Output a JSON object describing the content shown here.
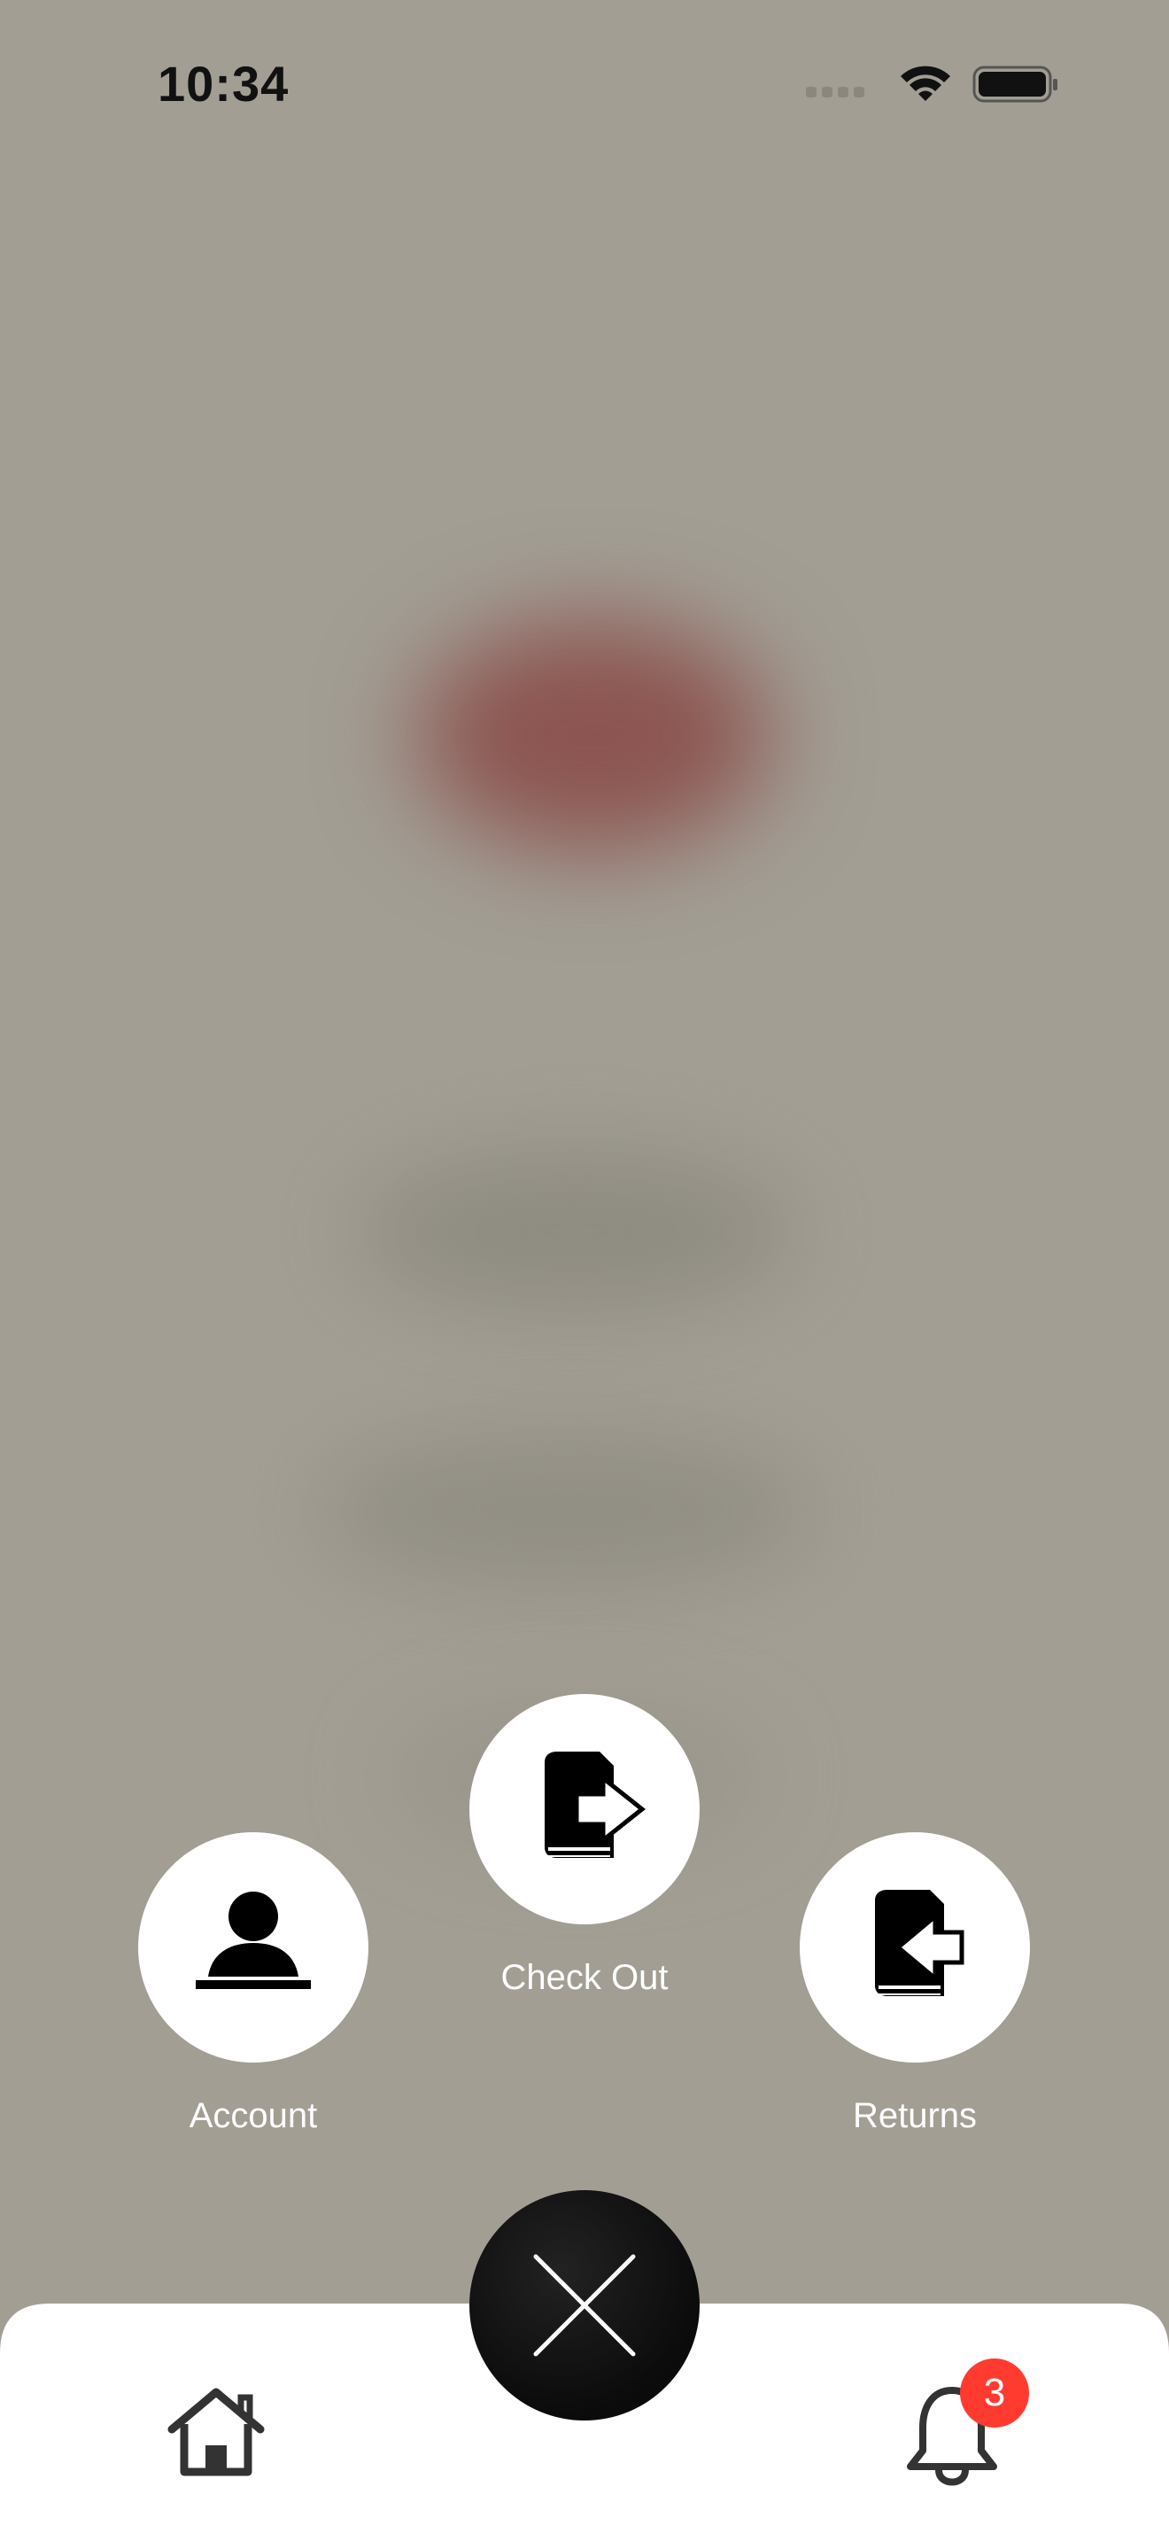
{
  "status_bar": {
    "time": "10:34"
  },
  "actions": {
    "account": {
      "label": "Account",
      "icon": "person-at-desk-icon"
    },
    "check_out": {
      "label": "Check Out",
      "icon": "book-export-icon"
    },
    "returns": {
      "label": "Returns",
      "icon": "book-import-icon"
    }
  },
  "tab_bar": {
    "home_icon": "home-icon",
    "close_icon": "close-icon",
    "notifications_icon": "bell-icon",
    "notification_badge": "3"
  },
  "colors": {
    "overlay": "#a29e94",
    "badge": "#ff3b30",
    "fab": "#111111"
  }
}
